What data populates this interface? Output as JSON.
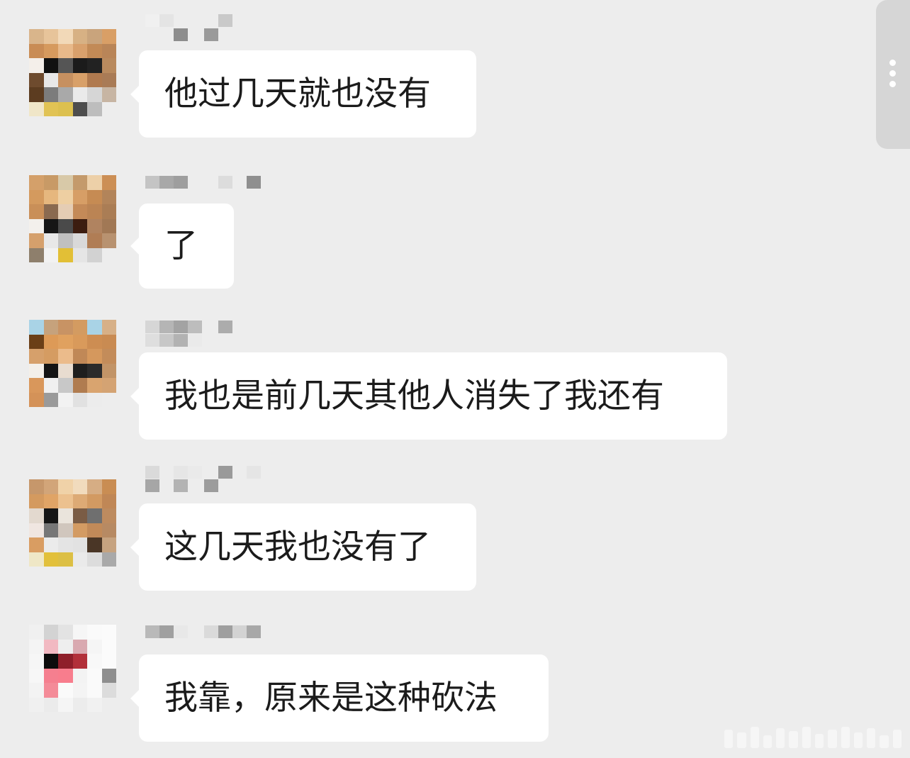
{
  "messages": [
    {
      "text": "他过几天就也没有"
    },
    {
      "text": "了"
    },
    {
      "text": "我也是前几天其他人消失了我还有"
    },
    {
      "text": "这几天我也没有了"
    },
    {
      "text": "我靠，原来是这种砍法"
    }
  ],
  "colors": {
    "background": "#ededed",
    "bubble": "#ffffff",
    "text": "#1b1b1b"
  },
  "icons": {
    "more": "vertical-dots-icon"
  }
}
